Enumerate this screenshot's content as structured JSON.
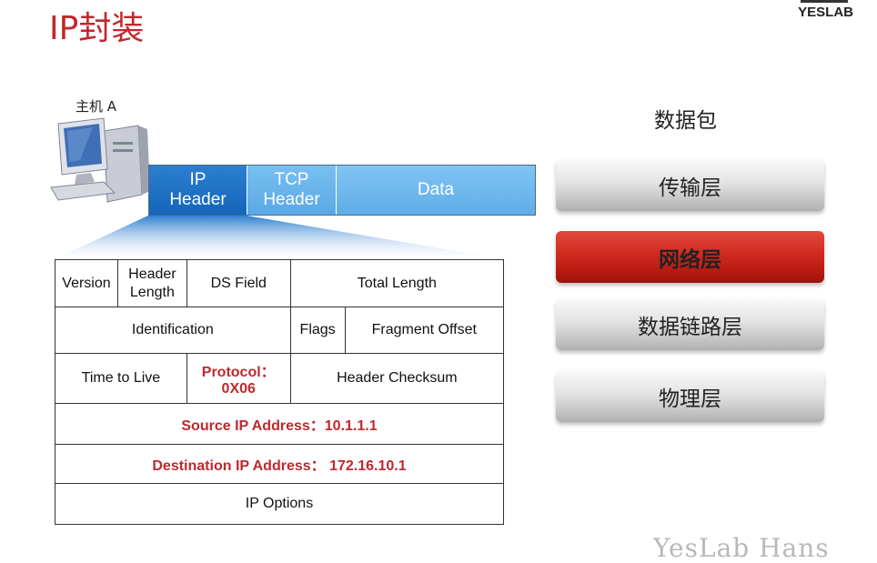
{
  "title": "IP封装",
  "brand": "YESLAB",
  "host_label": "主机 A",
  "packet": {
    "ip_header": "IP\nHeader",
    "tcp_header": "TCP\nHeader",
    "data": "Data"
  },
  "header_table": {
    "version": "Version",
    "header_length": "Header\nLength",
    "ds_field": "DS Field",
    "total_length": "Total Length",
    "identification": "Identification",
    "flags": "Flags",
    "fragment_offset": "Fragment Offset",
    "ttl": "Time to Live",
    "protocol": "Protocol：0X06",
    "header_checksum": "Header Checksum",
    "source_ip": "Source IP Address：10.1.1.1",
    "destination_ip": "Destination IP Address： 172.16.10.1",
    "ip_options": "IP  Options"
  },
  "stack": {
    "label": "数据包",
    "layers": [
      "传输层",
      "网络层",
      "数据链路层",
      "物理层"
    ],
    "highlight_color": "#cf2a1f"
  },
  "watermark": "YesLab Hans"
}
